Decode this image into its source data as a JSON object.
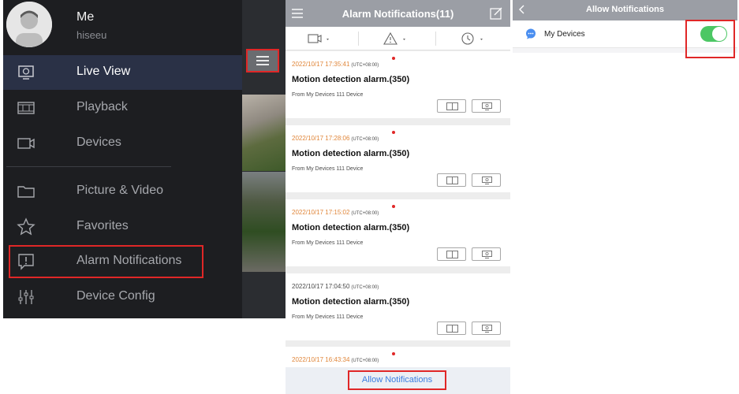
{
  "side_menu": {
    "user": {
      "name": "Me",
      "account": "hiseeu"
    },
    "items": [
      {
        "label": "Live View",
        "icon": "monitor-icon",
        "active": true
      },
      {
        "label": "Playback",
        "icon": "film-icon",
        "active": false
      },
      {
        "label": "Devices",
        "icon": "camera-icon",
        "active": false
      },
      {
        "label": "Picture & Video",
        "icon": "folder-icon",
        "active": false
      },
      {
        "label": "Favorites",
        "icon": "star-icon",
        "active": false
      },
      {
        "label": "Alarm Notifications",
        "icon": "alarm-message-icon",
        "active": false
      },
      {
        "label": "Device Config",
        "icon": "sliders-icon",
        "active": false
      }
    ]
  },
  "alarm_panel": {
    "title": "Alarm Notifications(11)",
    "filters": [
      "device-filter-icon",
      "alarm-type-filter-icon",
      "time-filter-icon"
    ],
    "notifications": [
      {
        "date": "2022/10/17 17:35:41",
        "timezone": "(UTC+08:00)",
        "unread": true,
        "title": "Motion detection alarm.(350)",
        "source": "From My Devices 111 Device"
      },
      {
        "date": "2022/10/17 17:28:06",
        "timezone": "(UTC+08:00)",
        "unread": true,
        "title": "Motion detection alarm.(350)",
        "source": "From My Devices 111 Device"
      },
      {
        "date": "2022/10/17 17:15:02",
        "timezone": "(UTC+08:00)",
        "unread": true,
        "title": "Motion detection alarm.(350)",
        "source": "From My Devices 111 Device"
      },
      {
        "date": "2022/10/17 17:04:50",
        "timezone": "(UTC+08:00)",
        "unread": false,
        "title": "Motion detection alarm.(350)",
        "source": "From My Devices 111 Device"
      },
      {
        "date": "2022/10/17 16:43:34",
        "timezone": "(UTC+08:00)",
        "unread": true
      }
    ],
    "footer_button": "Allow Notifications"
  },
  "allow_panel": {
    "title": "Allow Notifications",
    "row": {
      "label": "My Devices",
      "enabled": true
    }
  },
  "colors": {
    "highlight": "#e02727",
    "unread_time": "#e0863a",
    "toggle_on": "#4cc764",
    "link": "#3b7de0",
    "header": "#9b9ea5"
  }
}
